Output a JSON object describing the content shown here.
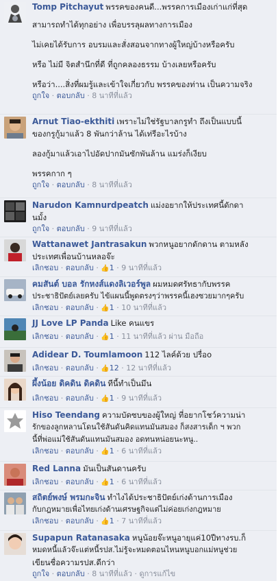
{
  "ui": {
    "like": "ถูกใจ",
    "unlike": "เลิกชอบ",
    "reply": "ตอบกลับ",
    "view_edit": "ดูการแก้ไข"
  },
  "comments": [
    {
      "name": "Tomp Pitchayut",
      "text": [
        "พรรคของคนดี...พรรคการเมืองเก่าแก่ที่สุด",
        "สามารถทำได้ทุกอย่าง เพื่อบรรลุผลทางการเมือง",
        "",
        "ไม่เคยได้รับการ อบรมและสั่งสอนจากทางผู้ใหญ่บ้างหรือครับ",
        "",
        "หรือ ไม่มี จิตสำนึกที่ดี ที่ถูกคลองธรรม บ้างเลยหรือครับ",
        "",
        "หรือว่า....สิ่งที่ผมรู้และเข้าใจเกี่ยวกับ พรรคของท่าน เป็นความจริง"
      ],
      "time": "8 นาทีที่แล้ว"
    },
    {
      "name": "Arnut Tiao-ekthiti",
      "text": [
        "เพราะไม่ใช่รัฐบาลกรูทำ ถึงเป็นแบบนี้",
        "ของกรูกู้มาแล้ว 8 พันกว่าล้าน ได้เท่รีอะไรบ้าง",
        "",
        "ลองกู้มาแล้วเอาไปอัดปากมันซักพันล้าน แมร่งก็เงียบ",
        "",
        "พรรคกาก ๆ"
      ],
      "time": "8 นาทีที่แล้ว"
    },
    {
      "name": "Narudon Kamnurdpeatch",
      "text": [
        "แม่งอยากให้ประเทศนี้ดักดา",
        "นมั้ง"
      ],
      "time": "9 นาทีที่แล้ว"
    },
    {
      "name": "Wattanawet Jantrasakun",
      "text": [
        "พวกหนูอยากดักดาน ตามหลัง",
        "ประเทศเพื่อนบ้านหลอจ๊ะ"
      ],
      "likes": "1",
      "time": "9 นาทีที่แล้ว"
    },
    {
      "name": "คมสันต์ บอล รักหงส์แดงลิเวอร์พูล",
      "text": [
        "ผมหมดศรัทธากับพรรค",
        "ประชาธิปัตย์เลยครับ ไข้แผนนี้พูดตรงๆว่าพรรคนี้เฮงซวยมากๆครับ"
      ],
      "likes": "1",
      "time": "10 นาทีที่แล้ว"
    },
    {
      "name": "JJ Love LP Panda",
      "text": [
        "Like คนแขร"
      ],
      "likes": "1",
      "time": "11 นาทีที่แล้ว",
      "via": "ผ่าน มือถือ"
    },
    {
      "name": "Adidear D. Toumlamoon",
      "text": [
        "112 ไลค์ด้วย ปรื่อo"
      ],
      "likes": "12",
      "time": "12 นาทีที่แล้ว"
    },
    {
      "name": "ผึ้งน้อย ดิคดิน ดิคดิน",
      "text": [
        "ทีนี้ทำเป็นมึน"
      ],
      "likes": "1",
      "time": "9 นาทีที่แล้ว"
    },
    {
      "name": "Hiso Teendang",
      "text": [
        "ความบัดซบของผู้ใหญ่ ที่อยากโชว์ความน่า",
        "รักของลูกหลานโดนใช้สันดันคิดแทนมันสมอง ก็สงสารเด็ก ฯ พวก",
        "นี้ที่พ่อแม่ใช้สันดันแทนมันสมอง อดทนหน่อยนะหนู.."
      ],
      "likes": "1",
      "time": "6 นาทีที่แล้ว"
    },
    {
      "name": "Red Lanna",
      "text": [
        "มันเป็นสันดานครับ"
      ],
      "likes": "1",
      "time": "6 นาทีที่แล้ว"
    },
    {
      "name": "สถิตย์พงษ์ พรมกะจิน",
      "text": [
        "ทำไงได้ประชาธิปัตย์เก่งด้านการเมือง",
        "กับกฎหมายเพื่อไทยเก่งด้านเศรษฐกิจแต่ไม่ค่อยเก่งกฎหมาย"
      ],
      "likes": "1",
      "time": "7 นาทีที่แล้ว"
    },
    {
      "name": "Supapun Ratanasaka",
      "text": [
        "หนูน้อยจ๊ะหนูอายุแค่10ปีทางรบ.ก็",
        "หมดหนี้แล้วจ๊ะแต่หนี้รปส.ไม่รู้จะหมดตอนไหนหนูบอกแม่หนูช่วย",
        "เขียนชื่อความรปส.ดีกว่า"
      ],
      "time": "8 นาทีที่แล้ว",
      "edited": true
    }
  ]
}
